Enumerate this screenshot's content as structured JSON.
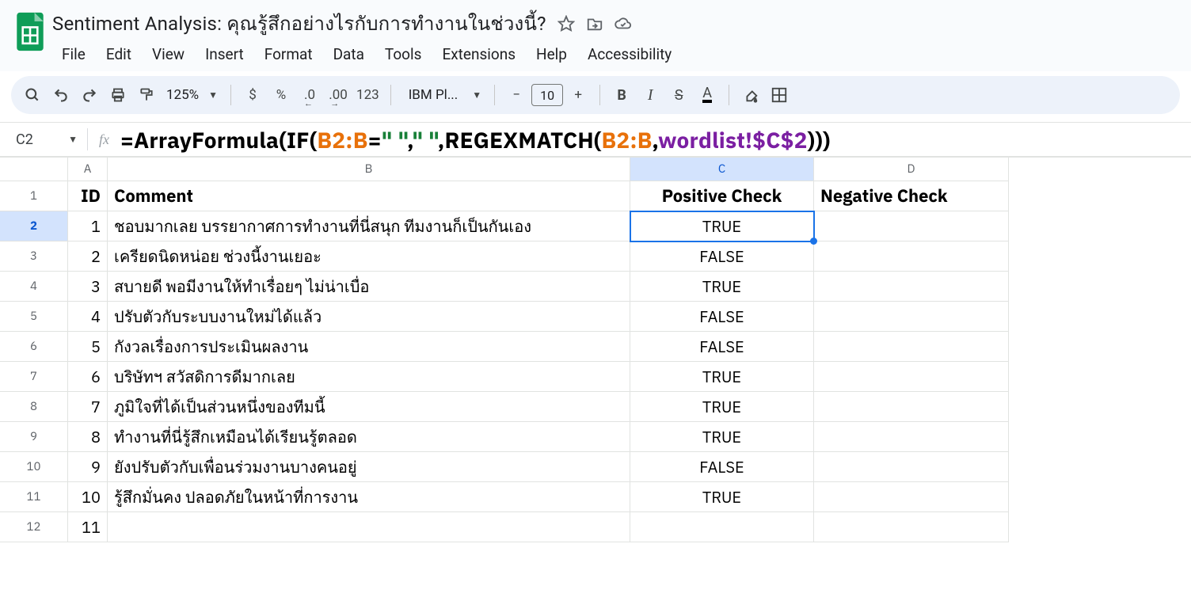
{
  "doc": {
    "title": "Sentiment Analysis: คุณรู้สึกอย่างไรกับการทำงานในช่วงนี้?"
  },
  "menus": [
    "File",
    "Edit",
    "View",
    "Insert",
    "Format",
    "Data",
    "Tools",
    "Extensions",
    "Help",
    "Accessibility"
  ],
  "toolbar": {
    "zoom": "125%",
    "currency": "$",
    "percent": "%",
    "dec_dec": ".0",
    "inc_dec": ".00",
    "num_fmt": "123",
    "font_name": "IBM Pl...",
    "font_size": "10",
    "minus": "−",
    "plus": "+",
    "bold": "B",
    "italic": "I",
    "strike": "S",
    "text_color": "A"
  },
  "formula_bar": {
    "cell_ref": "C2",
    "fx": "fx",
    "parts": [
      {
        "t": "=",
        "c": "f-black"
      },
      {
        "t": "ArrayFormula",
        "c": "f-black"
      },
      {
        "t": "(",
        "c": "f-black"
      },
      {
        "t": "IF",
        "c": "f-black"
      },
      {
        "t": "(",
        "c": "f-black"
      },
      {
        "t": "B2:B",
        "c": "f-orange"
      },
      {
        "t": "=",
        "c": "f-black"
      },
      {
        "t": "\" \"",
        "c": "f-green"
      },
      {
        "t": ",",
        "c": "f-black"
      },
      {
        "t": "\" \"",
        "c": "f-green"
      },
      {
        "t": ",",
        "c": "f-black"
      },
      {
        "t": "REGEXMATCH",
        "c": "f-black"
      },
      {
        "t": "(",
        "c": "f-black"
      },
      {
        "t": "B2:B",
        "c": "f-orange"
      },
      {
        "t": ",",
        "c": "f-black"
      },
      {
        "t": "wordlist!$C$2",
        "c": "f-purple"
      },
      {
        "t": ")",
        "c": "f-black"
      },
      {
        "t": ")",
        "c": "f-black"
      },
      {
        "t": ")",
        "c": "f-black"
      }
    ]
  },
  "grid": {
    "columns": [
      "A",
      "B",
      "C",
      "D"
    ],
    "active_col_index": 2,
    "active_row": 2,
    "selected_cell": "C2",
    "headers": {
      "A": "ID",
      "B": "Comment",
      "C": "Positive Check",
      "D": "Negative Check"
    },
    "rows": [
      {
        "n": 1,
        "id": "1",
        "comment": "ชอบมากเลย บรรยากาศการทำงานที่นี่สนุก ทีมงานก็เป็นกันเอง",
        "pos": "TRUE",
        "neg": ""
      },
      {
        "n": 2,
        "id": "2",
        "comment": "เครียดนิดหน่อย ช่วงนี้งานเยอะ",
        "pos": "FALSE",
        "neg": ""
      },
      {
        "n": 3,
        "id": "3",
        "comment": "สบายดี พอมีงานให้ทำเรื่อยๆ ไม่น่าเบื่อ",
        "pos": "TRUE",
        "neg": ""
      },
      {
        "n": 4,
        "id": "4",
        "comment": "ปรับตัวกับระบบงานใหม่ได้แล้ว",
        "pos": "FALSE",
        "neg": ""
      },
      {
        "n": 5,
        "id": "5",
        "comment": "กังวลเรื่องการประเมินผลงาน",
        "pos": "FALSE",
        "neg": ""
      },
      {
        "n": 6,
        "id": "6",
        "comment": "บริษัทฯ สวัสดิการดีมากเลย",
        "pos": "TRUE",
        "neg": ""
      },
      {
        "n": 7,
        "id": "7",
        "comment": "ภูมิใจที่ได้เป็นส่วนหนึ่งของทีมนี้",
        "pos": "TRUE",
        "neg": ""
      },
      {
        "n": 8,
        "id": "8",
        "comment": "ทำงานที่นี่รู้สึกเหมือนได้เรียนรู้ตลอด",
        "pos": "TRUE",
        "neg": ""
      },
      {
        "n": 9,
        "id": "9",
        "comment": "ยังปรับตัวกับเพื่อนร่วมงานบางคนอยู่",
        "pos": "FALSE",
        "neg": ""
      },
      {
        "n": 10,
        "id": "10",
        "comment": "รู้สึกมั่นคง ปลอดภัยในหน้าที่การงาน",
        "pos": "TRUE",
        "neg": ""
      },
      {
        "n": 11,
        "id": "11",
        "comment": "",
        "pos": "",
        "neg": ""
      }
    ]
  }
}
